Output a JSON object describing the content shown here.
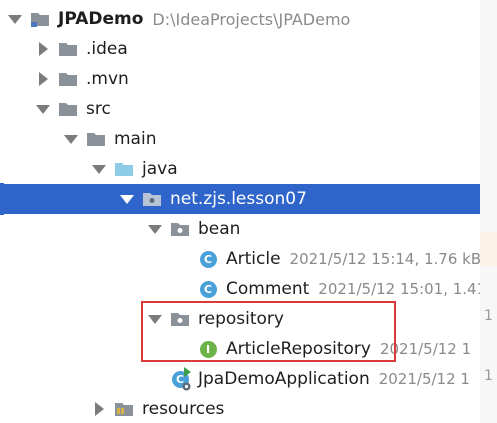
{
  "project": {
    "name": "JPADemo",
    "path": "D:\\IdeaProjects\\JPADemo"
  },
  "nodes": {
    "idea": ".idea",
    "mvn": ".mvn",
    "src": "src",
    "main": "main",
    "java": "java",
    "pkg": "net.zjs.lesson07",
    "bean": "bean",
    "article": {
      "name": "Article",
      "meta": "2021/5/12 15:14, 1.76 kB"
    },
    "comment": {
      "name": "Comment",
      "meta": "2021/5/12 15:01, 1.41"
    },
    "repository": "repository",
    "article_repository": {
      "name": "ArticleRepository",
      "meta": "2021/5/12 1"
    },
    "app": {
      "name": "JpaDemoApplication",
      "meta": "2021/5/12 1"
    },
    "resources": "resources"
  },
  "icons": {
    "class_badge": "C",
    "interface_badge": "I"
  },
  "edge_numbers": [
    "1",
    "1"
  ],
  "colors": {
    "selection": "#2f65ca",
    "folder": "#8a9199",
    "source_folder": "#8ecbe8",
    "class_icon": "#4aa1d9",
    "interface_icon": "#6cb34a",
    "highlight": "#d93a3a"
  }
}
